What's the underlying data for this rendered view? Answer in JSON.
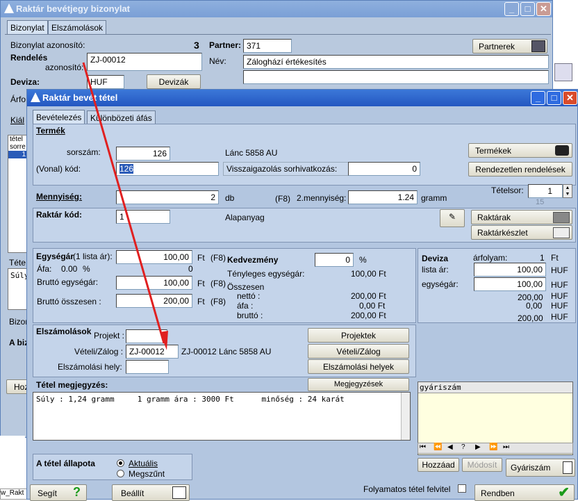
{
  "back_window": {
    "title": "Raktár bevétjegy bizonylat",
    "tabs": [
      "Bizonylat",
      "Elszámolások"
    ],
    "doc_id_label": "Bizonylat azonosító:",
    "doc_id_value": "3",
    "rendeles_label1": "Rendelés",
    "rendeles_label2": "azonosító:",
    "rendeles_value": "ZJ-00012",
    "partner_label": "Partner:",
    "partner_value": "371",
    "partnerek_btn": "Partnerek",
    "nev_label": "Név:",
    "nev_value": "Záloghází értékesítés",
    "deviza_label": "Deviza:",
    "deviza_value": "HUF",
    "devizak_btn": "Devizák",
    "arfo_label": "Árfo",
    "kial_label": "Kiál",
    "tetel_label": "tétel",
    "sorre_label": "sorre",
    "row1": "1",
    "tetel2_label": "Téte",
    "suly_label": "Súly",
    "bizon_label": "Bizon",
    "abiz_label": "A biz",
    "hoz_label": "Hoz",
    "taskbar_label": "w_Rakt"
  },
  "window": {
    "title": "Raktár bevét tétel",
    "tabs": [
      "Bevételezés",
      "Különbözeti áfás"
    ]
  },
  "termek": {
    "heading": "Termék",
    "sorszam_label": "sorszám:",
    "sorszam_value": "126",
    "product_name": "Lánc 5858 AU",
    "vonalkod_label": "(Vonal) kód:",
    "vonalkod_value": "126",
    "visszaig_label": "Visszaigazolás sorhivatkozás:",
    "visszaig_value": "0",
    "termekek_btn": "Termékek",
    "rendezetlen_btn": "Rendezetlen rendelések"
  },
  "mennyiseg": {
    "label": "Mennyiség:",
    "value": "2",
    "unit": "db",
    "f8": "(F8)",
    "menny2_label": "2.mennyiség:",
    "menny2_value": "1.24",
    "menny2_unit": "gramm",
    "tetelsor_label": "Tételsor:",
    "tetelsor_value": "1",
    "tetelsor_sub": "15"
  },
  "raktar": {
    "label": "Raktár kód:",
    "value": "1",
    "name": "Alapanyag",
    "raktarak_btn": "Raktárak",
    "keszlet_btn": "Raktárkészlet"
  },
  "ar": {
    "egysegar_label": "Egységár",
    "lista_label": "(1 lista ár):",
    "egysegar_value": "100,00",
    "ft": "Ft",
    "f8": "(F8)",
    "afa_label": "Áfa:",
    "afa_value": "0.00",
    "pct": "%",
    "afa_count": "0",
    "brutto_egysegar_label": "Bruttó egységár:",
    "brutto_egysegar_value": "100,00",
    "brutto_osszesen_label": "Bruttó összesen :",
    "brutto_osszesen_value": "200,00",
    "kedv_label": "Kedvezmény",
    "kedv_value": "0",
    "tenyleges_label": "Tényleges egységár:",
    "tenyleges_value": "100,00 Ft",
    "osszesen_label": "Összesen",
    "netto_label": "nettó :",
    "netto_value": "200,00 Ft",
    "afa2_label": "áfa :",
    "afa2_value": "0,00 Ft",
    "brutto2_label": "bruttó :",
    "brutto2_value": "200,00 Ft"
  },
  "deviza": {
    "label": "Deviza",
    "arfolyam_label": "árfolyam:",
    "arfolyam_value": "1",
    "arfolyam_unit": "Ft",
    "lista_label": "lista ár:",
    "lista_value": "100,00",
    "egyseg_label": "egységár:",
    "egyseg_value": "100,00",
    "huf": "HUF",
    "tot1": "200,00",
    "tot2": "0,00",
    "tot3": "200,00"
  },
  "elszamolasok": {
    "heading": "Elszámolások",
    "projekt_label": "Projekt :",
    "projekt_value": "",
    "veteli_label": "Vételi/Zálog :",
    "veteli_value": "ZJ-00012",
    "veteli_desc": "ZJ-00012 Lánc 5858 AU",
    "hely_label": "Elszámolási hely:",
    "hely_value": "",
    "projektek_btn": "Projektek",
    "veteli_btn": "Vételi/Zálog",
    "helyek_btn": "Elszámolási helyek"
  },
  "megjegyzes": {
    "label": "Tétel megjegyzés:",
    "btn": "Megjegyzések",
    "text": "Súly : 1,24 gramm     1 gramm ára : 3000 Ft      minőség : 24 karát"
  },
  "gyariszam": {
    "header": "gyáriszám",
    "nav": [
      "⏮",
      "⏪",
      "◀",
      "?",
      "▶",
      "⏩",
      "⏭"
    ],
    "hozzaad_btn": "Hozzáad",
    "modosit_btn": "Módosít",
    "gyariszam_btn": "Gyáriszám"
  },
  "allapot": {
    "label": "A tétel állapota",
    "aktualis": "Aktuális",
    "megszunt": "Megszűnt"
  },
  "bottom": {
    "segit_btn": "Segít",
    "beallit_btn": "Beállít",
    "folyamatos_label": "Folyamatos tétel felvitel",
    "rendben_btn": "Rendben"
  },
  "colors": {
    "title": "#2457c1",
    "panel": "#c4d4ea",
    "arrow": "#e02020"
  }
}
